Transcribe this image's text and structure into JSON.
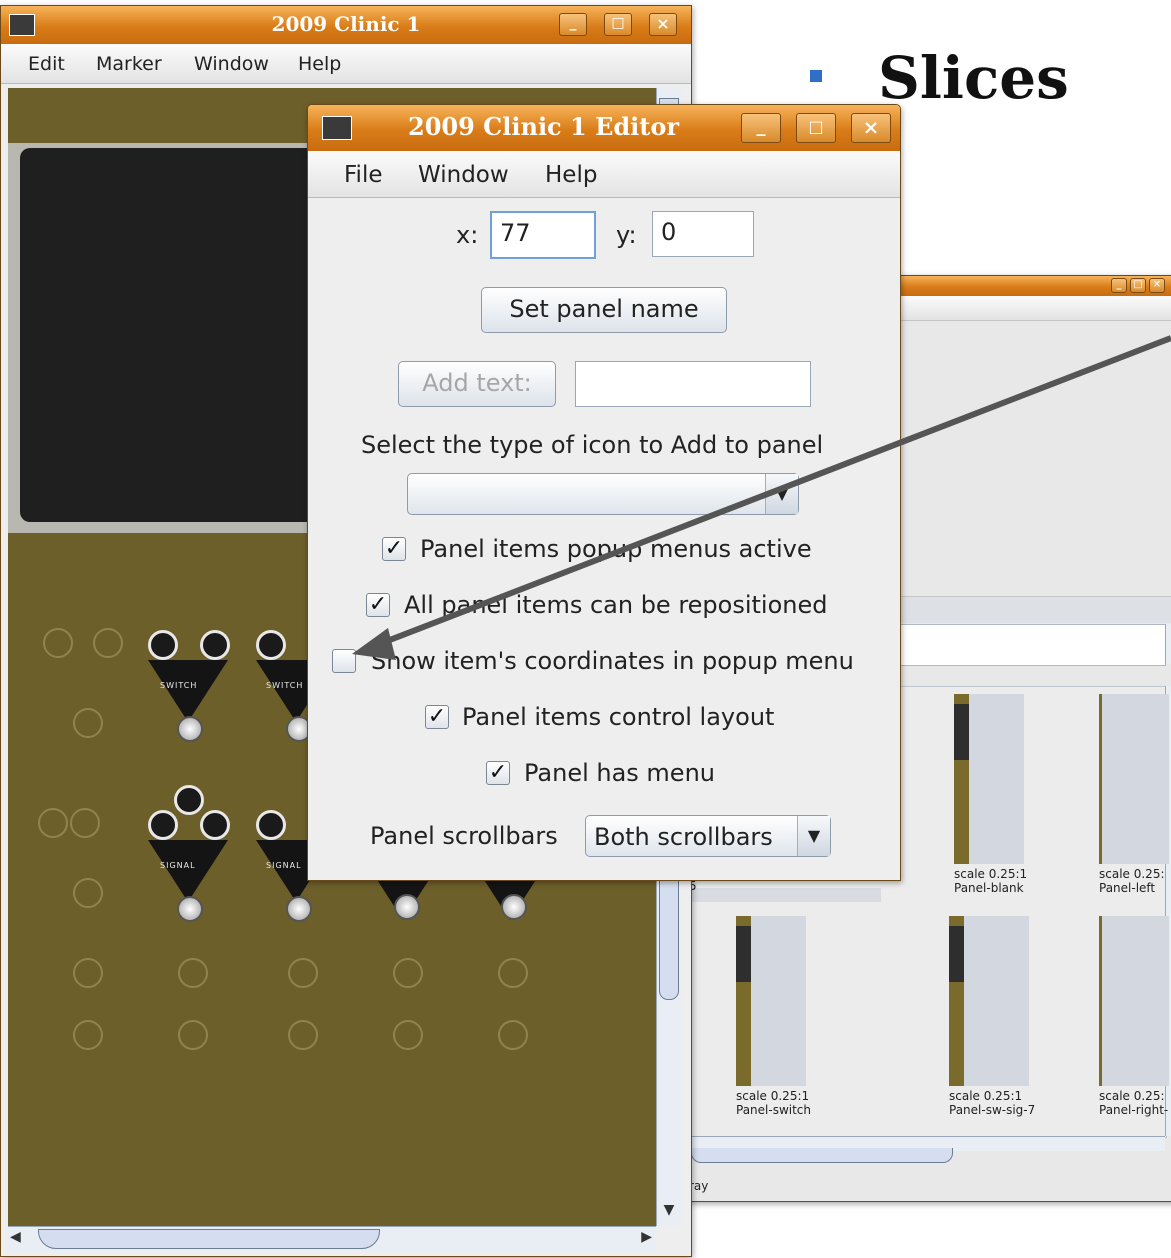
{
  "slide": {
    "title": "Slices"
  },
  "panel_window": {
    "title": "2009 Clinic 1",
    "menu": [
      "Edit",
      "Marker",
      "Window",
      "Help"
    ],
    "plate_labels": [
      "SWITCH",
      "SWITCH",
      "SIGNAL",
      "SIGNAL"
    ]
  },
  "editor_window": {
    "title": "2009 Clinic 1 Editor",
    "menu": [
      "File",
      "Window",
      "Help"
    ],
    "x_label": "x:",
    "x_value": "77",
    "y_label": "y:",
    "y_value": "0",
    "set_name_label": "Set panel name",
    "add_text_label": "Add text:",
    "add_text_value": "",
    "icon_type_label": "Select the type of icon to Add to panel",
    "icon_type_value": "",
    "checkboxes": [
      {
        "label": "Panel items popup menus active",
        "checked": true
      },
      {
        "label": "All panel items can be repositioned",
        "checked": true
      },
      {
        "label": "Show item's coordinates in popup menu",
        "checked": false
      },
      {
        "label": "Panel items control layout",
        "checked": true
      },
      {
        "label": "Panel has menu",
        "checked": true
      }
    ],
    "scrollbars_label": "Panel scrollbars",
    "scrollbars_value": "Both scrollbars"
  },
  "palette_window": {
    "thumbnails": [
      {
        "scale": "scale 0.25:1",
        "name": "Panel-blank"
      },
      {
        "scale": "scale 0.25:",
        "name": "Panel-left"
      },
      {
        "scale": "scale 0.25:1",
        "name": "Panel-switch"
      },
      {
        "scale": "scale 0.25:1",
        "name": "Panel-sw-sig-7"
      },
      {
        "scale": "scale 0.25:",
        "name": "Panel-right-"
      }
    ],
    "stray_digit": "5",
    "status_fragment": "ray"
  },
  "colors": {
    "titlebar": "#d97c18",
    "panel_olive": "#6d5f2a",
    "arrow": "#555555"
  }
}
